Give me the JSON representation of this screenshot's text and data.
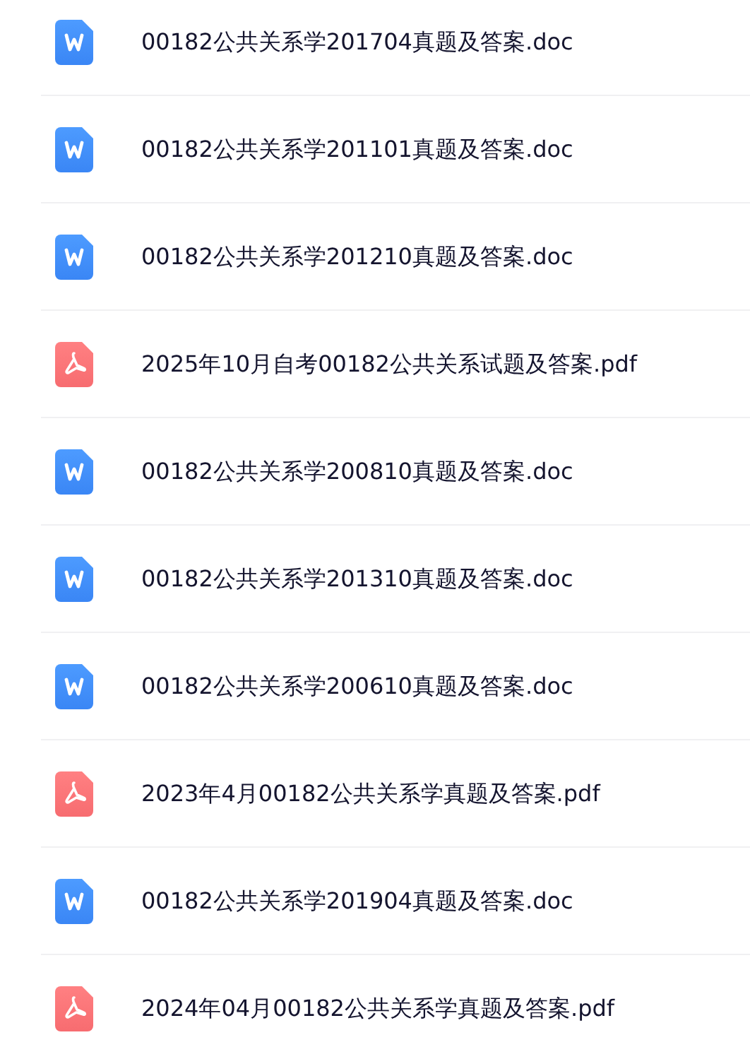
{
  "files": [
    {
      "kind": "doc",
      "name": "00182公共关系学201704真题及答案.doc"
    },
    {
      "kind": "doc",
      "name": "00182公共关系学201101真题及答案.doc"
    },
    {
      "kind": "doc",
      "name": "00182公共关系学201210真题及答案.doc"
    },
    {
      "kind": "pdf",
      "name": "2025年10月自考00182公共关系试题及答案.pdf"
    },
    {
      "kind": "doc",
      "name": "00182公共关系学200810真题及答案.doc"
    },
    {
      "kind": "doc",
      "name": "00182公共关系学201310真题及答案.doc"
    },
    {
      "kind": "doc",
      "name": "00182公共关系学200610真题及答案.doc"
    },
    {
      "kind": "pdf",
      "name": "2023年4月00182公共关系学真题及答案.pdf"
    },
    {
      "kind": "doc",
      "name": "00182公共关系学201904真题及答案.doc"
    },
    {
      "kind": "pdf",
      "name": "2024年04月00182公共关系学真题及答案.pdf"
    }
  ]
}
